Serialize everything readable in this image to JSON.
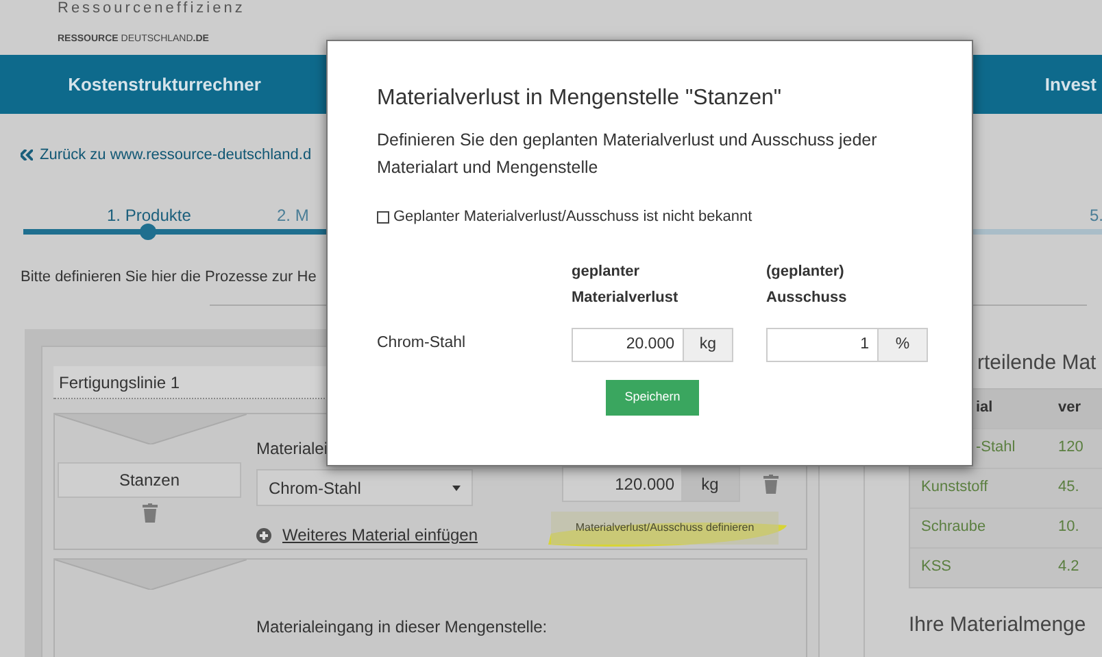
{
  "header": {
    "logo_title": "Ressourceneffizienz",
    "logo_subtitle": "**RESSOURCE** DEUTSCHLAND**.DE**"
  },
  "nav": [
    {
      "label": "Kostenstrukturrechner"
    },
    {
      "label": "Invest"
    }
  ],
  "back_link": "Zurück zu www.ressource-deutschland.d",
  "steps": [
    {
      "label": "1. Produkte",
      "selected": true
    },
    {
      "label": "2. M",
      "selected": false
    },
    {
      "label": "5.",
      "selected": false
    }
  ],
  "intro": "Bitte definieren Sie hier die Prozesse zur He",
  "production_line": {
    "name": "Fertigungslinie 1",
    "station": {
      "name": "Stanzen",
      "input_label": "Materialei",
      "material": "Chrom-Stahl",
      "quantity": "120.000",
      "unit": "kg",
      "add_link": "Weiteres Material einfügen",
      "loss_button": "Materialverlust/Ausschuss definieren"
    },
    "next_station": {
      "input_label": "Materialeingang in dieser Mengenstelle:"
    }
  },
  "summary": {
    "title": "rteilende Mat",
    "columns": [
      "ial",
      "ver"
    ],
    "rows": [
      [
        "-Stahl",
        "120"
      ],
      [
        "Kunststoff",
        "45."
      ],
      [
        "Schraube",
        "10."
      ],
      [
        "KSS",
        "4.2"
      ]
    ],
    "subtitle": "Ihre Materialmenge"
  },
  "modal": {
    "title": "Materialverlust in Mengenstelle \"Stanzen\"",
    "description": "Definieren Sie den geplanten Materialverlust und Ausschuss jeder Materialart und Mengenstelle",
    "unknown_checkbox": {
      "label": "Geplanter Materialverlust/Ausschuss ist nicht bekannt",
      "checked": false
    },
    "columns": [
      "geplanter Materialverlust",
      "(geplanter) Ausschuss"
    ],
    "rows": [
      {
        "material": "Chrom-Stahl",
        "loss": "20.000",
        "loss_unit": "kg",
        "scrap": "1",
        "scrap_unit": "%"
      }
    ],
    "save_button": "Speichern"
  }
}
